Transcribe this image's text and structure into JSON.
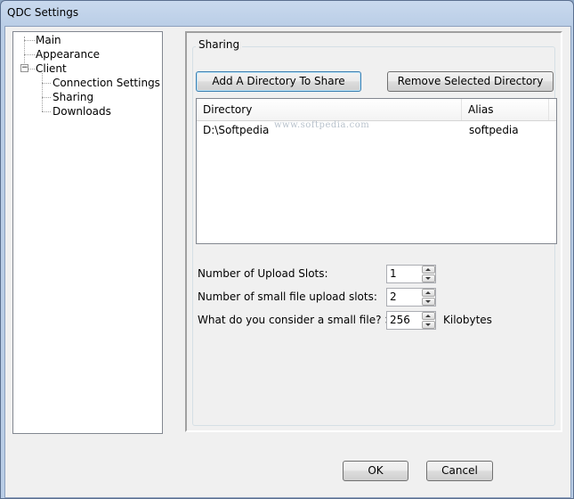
{
  "window": {
    "title": "QDC Settings"
  },
  "tree": {
    "items": [
      {
        "label": "Main",
        "level": 0
      },
      {
        "label": "Appearance",
        "level": 0
      },
      {
        "label": "Client",
        "level": 0,
        "expanded": true
      },
      {
        "label": "Connection Settings",
        "level": 1
      },
      {
        "label": "Sharing",
        "level": 1
      },
      {
        "label": "Downloads",
        "level": 1
      }
    ],
    "expander_glyph": "−"
  },
  "sharing": {
    "group_label": "Sharing",
    "add_button": "Add A Directory To Share",
    "remove_button": "Remove Selected Directory",
    "list": {
      "columns": [
        "Directory",
        "Alias"
      ],
      "rows": [
        {
          "directory": "D:\\Softpedia",
          "alias": "softpedia"
        }
      ]
    },
    "watermark": "www.softpedia.com",
    "fields": [
      {
        "label": "Number of Upload Slots:",
        "value": "1",
        "suffix": ""
      },
      {
        "label": "Number of small file upload slots:",
        "value": "2",
        "suffix": ""
      },
      {
        "label": "What do you consider a small file? >>>",
        "value": "256",
        "suffix": "Kilobytes"
      }
    ]
  },
  "footer": {
    "ok_label": "OK",
    "cancel_label": "Cancel"
  },
  "colors": {
    "focus_border": "#3c7fb1",
    "window_frame": "#b9cde6"
  }
}
